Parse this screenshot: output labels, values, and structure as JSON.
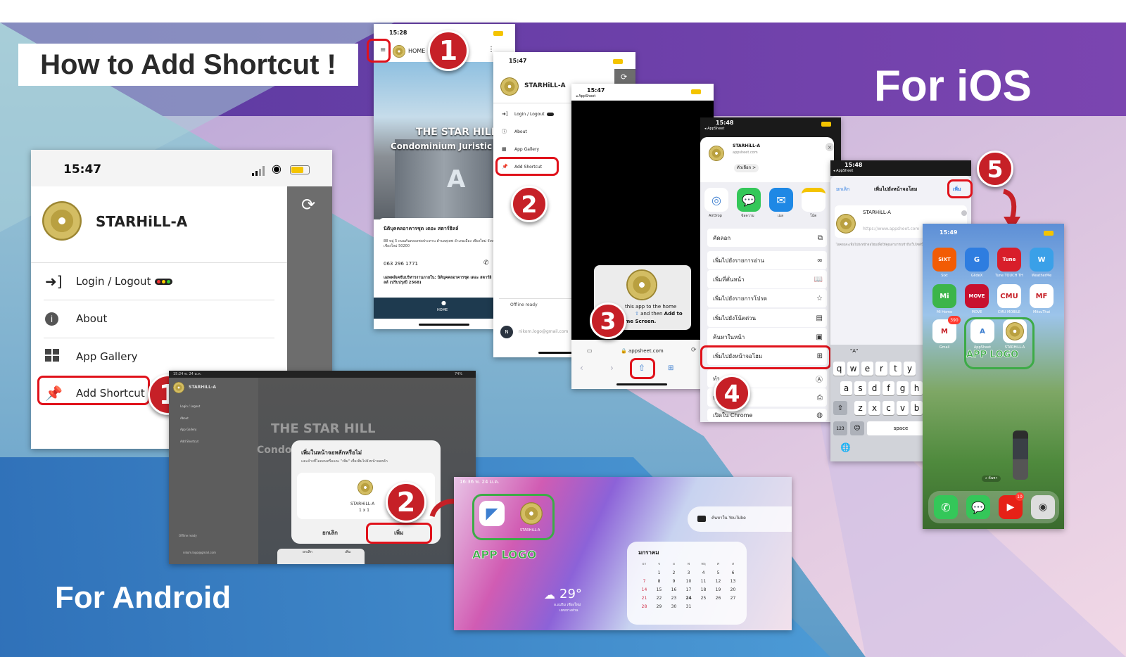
{
  "banner": {
    "title": "How to Add Shortcut !",
    "ios_label": "For iOS",
    "android_label": "For Android"
  },
  "colors": {
    "purple": "#6f40a8",
    "step_red": "#c62027",
    "highlight_red": "#e0121b",
    "highlight_green": "#3dab47",
    "accent_blue": "#3d7fd0"
  },
  "android_main": {
    "time": "15:47",
    "brand": "STARHiLL-A",
    "menu": [
      {
        "label": "Login / Logout",
        "icon": "login-icon"
      },
      {
        "label": "About",
        "icon": "info-icon"
      },
      {
        "label": "App Gallery",
        "icon": "grid-icon"
      },
      {
        "label": "Add Shortcut",
        "icon": "pin-icon"
      }
    ],
    "step": "1"
  },
  "android_dialog": {
    "time": "15:24",
    "date": "พ. 24 ม.ค.",
    "battery": "74%",
    "brand": "STARHiLL-A",
    "menu": [
      "Login / Logout",
      "About",
      "App Gallery",
      "Add Shortcut"
    ],
    "offline": "Offline ready",
    "email": "nikom.logo@gmail.com",
    "watermark": "THE STAR HILL",
    "watermark2": "Condo",
    "dialog_title": "เพิ่มในหน้าจอหลักหรือไม่",
    "dialog_sub": "แตะค้างที่ไอคอนหรือแตะ \"เพิ่ม\" เพื่อเพิ่มไปยังหน้าจอหลัก",
    "widget_name": "STARHiLL-A",
    "widget_size": "1 x 1",
    "cancel": "ยกเลิก",
    "add": "เพิ่ม",
    "add_bottom": "เพิ่ม",
    "cancel_bottom": "ยกเลิก",
    "step": "2"
  },
  "android_home": {
    "time": "16:36",
    "date": "พ. 24 ม.ค.",
    "app_logo_label": "APP LOGO",
    "icon_label": "STARHiLL-A",
    "search_text": "ค้นหาใน YouTube",
    "weather_temp": "29°",
    "weather_loc": "อ.แม่ริม เชียงใหม่",
    "weather_cond": "เมฆบางส่วน",
    "calendar_month": "มกราคม",
    "calendar_weekdays": [
      "อา",
      "จ",
      "อ",
      "พ",
      "พฤ",
      "ศ",
      "ส"
    ],
    "calendar_weeks": [
      [
        "",
        "1",
        "2",
        "3",
        "4",
        "5",
        "6"
      ],
      [
        "7",
        "8",
        "9",
        "10",
        "11",
        "12",
        "13"
      ],
      [
        "14",
        "15",
        "16",
        "17",
        "18",
        "19",
        "20"
      ],
      [
        "21",
        "22",
        "23",
        "24",
        "25",
        "26",
        "27"
      ],
      [
        "28",
        "29",
        "30",
        "31",
        "",
        "",
        ""
      ]
    ]
  },
  "ios1": {
    "time": "15:28",
    "home": "HOME",
    "building_title": "THE STAR HILL",
    "building_sub": "Condominium Juristic",
    "building_letter": "A",
    "info_title": "นิติบุคคลอาคารชุด เดอะ สตาร์ฮิลล์",
    "info_addr": "88 หมู่ 5 ถนนคันคลองชลประทาน ตำบลสุเทพ อำเภอเมือง เชียงใหม่ จังหวัดเชียงใหม่ 50200",
    "phone": "063 296 1771",
    "notice": "แอพพลิเคชันบริหารงานภายใน: นิติบุคคลอาคารชุด เดอะ สตาร์ฮิลล์ (ปรับปรุงปี 2568)",
    "nav_home": "HOME",
    "step": "1"
  },
  "ios2": {
    "time": "15:47",
    "brand": "STARHiLL-A",
    "menu": [
      "Login / Logout",
      "About",
      "App Gallery",
      "Add Shortcut"
    ],
    "offline": "Offline ready",
    "avatar": "N",
    "email": "nikom.logo@gmail.com",
    "step": "2"
  },
  "ios3": {
    "time": "15:47",
    "back_app": "◂ AppSheet",
    "popup_line1": "this app to the home",
    "popup_line2": "and then",
    "popup_bold": "Add to",
    "popup_line3": "me Screen.",
    "url": "appsheet.com",
    "step": "3"
  },
  "ios4": {
    "time": "15:48",
    "back_app": "◂ AppSheet",
    "site_name": "STARHiLL-A",
    "site_url": "appsheet.com",
    "options": "ตัวเลือก >",
    "share_apps": [
      "AirDrop",
      "ข้อความ",
      "เมล",
      "โน้ต"
    ],
    "actions": [
      {
        "label": "คัดลอก",
        "icon": "copy-icon"
      },
      {
        "label": "เพิ่มไปยังรายการอ่าน",
        "icon": "glasses-icon"
      },
      {
        "label": "เพิ่มที่คั่นหน้า",
        "icon": "book-icon"
      },
      {
        "label": "เพิ่มไปยังรายการโปรด",
        "icon": "star-icon"
      },
      {
        "label": "เพิ่มไปยังโน้ตด่วน",
        "icon": "note-icon"
      },
      {
        "label": "ค้นหาในหน้า",
        "icon": "find-icon"
      },
      {
        "label": "เพิ่มไปยังหน้าจอโฮม",
        "icon": "plus-square-icon"
      },
      {
        "label": "ทำ",
        "icon": "markup-icon"
      },
      {
        "label": "พ",
        "icon": "print-icon"
      },
      {
        "label": "เปิดใน Chrome",
        "icon": "chrome-icon"
      }
    ],
    "step": "4"
  },
  "ios5": {
    "time": "15:48",
    "back_app": "◂ AppSheet",
    "cancel": "ยกเลิก",
    "title": "เพิ่มไปยังหน้าจอโฮม",
    "add": "เพิ่ม",
    "name_value": "STARHiLL-A",
    "url": "https://www.appsheet.com",
    "hint": "ไอคอนจะเพิ่มไปยังหน้าจอโฮมเพื่อให้คุณสามารถเข้าถึงเว็บไซต์นี้ได้อย่างรวดเร็ว",
    "suggest": "\"A\"",
    "row1": [
      "q",
      "w",
      "e",
      "r",
      "t",
      "y"
    ],
    "row2": [
      "a",
      "s",
      "d",
      "f",
      "g",
      "h"
    ],
    "row3": [
      "z",
      "x",
      "c",
      "v",
      "b"
    ],
    "num_key": "123",
    "space": "space",
    "step": "5"
  },
  "ios6": {
    "time": "15:49",
    "apps_row1": [
      {
        "name": "Sixt",
        "text": "SiXT",
        "color": "#f25c05"
      },
      {
        "name": "GlideX",
        "text": "G",
        "color": "#2e7de0"
      },
      {
        "name": "Tune TOUCH TH",
        "text": "Tune",
        "color": "#d81e2a"
      },
      {
        "name": "WeatherMe",
        "text": "W",
        "color": "#3aa0e8"
      }
    ],
    "apps_row2": [
      {
        "name": "Mi Home",
        "text": "Mi",
        "color": "#3cb54a"
      },
      {
        "name": "MOVE",
        "text": "MOVE",
        "color": "#c8102e"
      },
      {
        "name": "CMU MOBILE",
        "text": "CMU",
        "color": "#ffffff"
      },
      {
        "name": "MitsuThai",
        "text": "MF",
        "color": "#ffffff"
      }
    ],
    "apps_row3": [
      {
        "name": "Gmail",
        "text": "M",
        "color": "#ffffff"
      },
      {
        "name": "AppSheet",
        "text": "A",
        "color": "#ffffff"
      },
      {
        "name": "STARHiLL-A",
        "text": "",
        "color": "#ffffff"
      }
    ],
    "gmail_badge": "390",
    "youtube_badge": "10",
    "app_logo_label": "APP LOGO",
    "search": "ค้นหา"
  }
}
